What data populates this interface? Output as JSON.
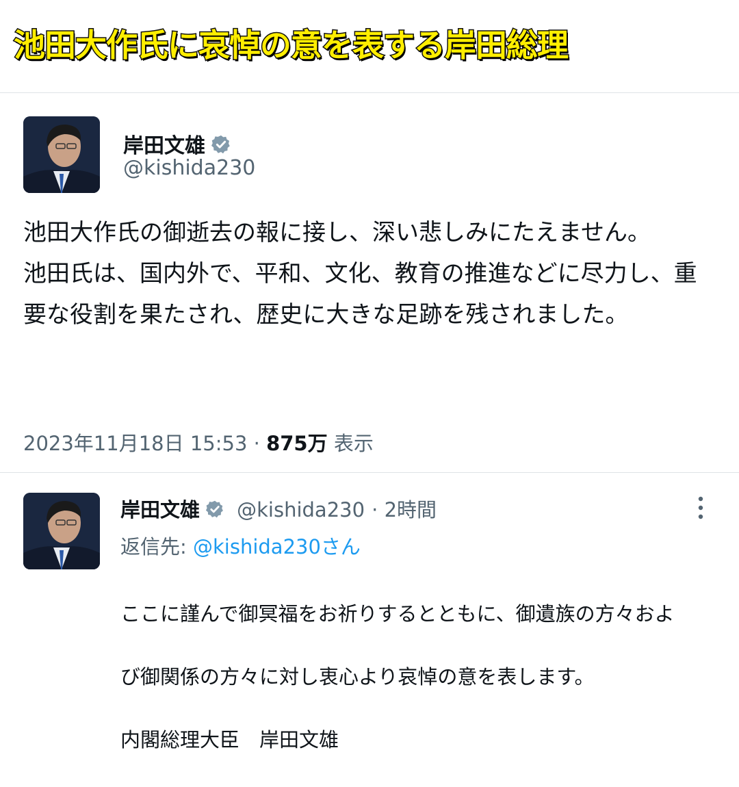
{
  "headline": "池田大作氏に哀悼の意を表する岸田総理",
  "colors": {
    "headline_fill": "#ffee00",
    "verified": "#829aab",
    "link": "#1d9bf0",
    "muted": "#536471"
  },
  "main_tweet": {
    "author_name": "岸田文雄",
    "author_handle": "@kishida230",
    "verified_icon": "verified-badge-icon",
    "text": "池田大作氏の御逝去の報に接し、深い悲しみにたえません。\n池田氏は、国内外で、平和、文化、教育の推進などに尽力し、重要な役割を果たされ、歴史に大きな足跡を残されました。",
    "timestamp": "2023年11月18日 15:53",
    "separator": "·",
    "views_count": "875万",
    "views_label": "表示"
  },
  "reply_tweet": {
    "author_name": "岸田文雄",
    "author_handle": "@kishida230",
    "time_ago": "· 2時間",
    "reply_to_label": "返信先:",
    "reply_to_handle": "@kishida230さん",
    "more_icon": "more-vertical-icon",
    "text_line1": "ここに謹んで御冥福をお祈りするとともに、御遺族の方々およ",
    "text_line2": "び御関係の方々に対し衷心より哀悼の意を表します。",
    "text_line3": "内閣総理大臣　岸田文雄"
  }
}
